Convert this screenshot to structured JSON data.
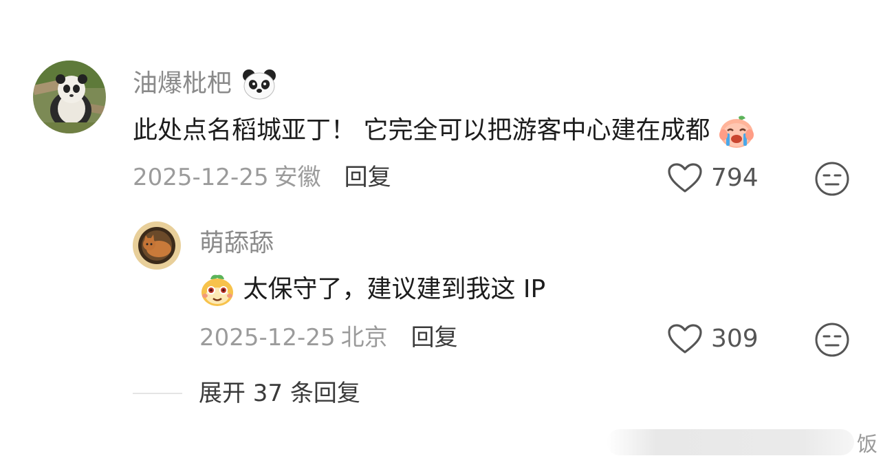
{
  "comment": {
    "username": "油爆枇杷",
    "username_emoji": "panda-face",
    "text": "此处点名稻城亚丁！ 它完全可以把游客中心建在成都",
    "text_emoji": "crying-peach-emoji",
    "date": "2025-12-25",
    "location": "安徽",
    "reply_label": "回复",
    "likes": "794"
  },
  "reply": {
    "username": "萌舔舔",
    "text_emoji": "peach-face-emoji",
    "text": "太保守了，建议建到我这 IP",
    "date": "2025-12-25",
    "location": "北京",
    "reply_label": "回复",
    "likes": "309"
  },
  "expand_label": "展开 37 条回复",
  "watermark_char": "饭"
}
